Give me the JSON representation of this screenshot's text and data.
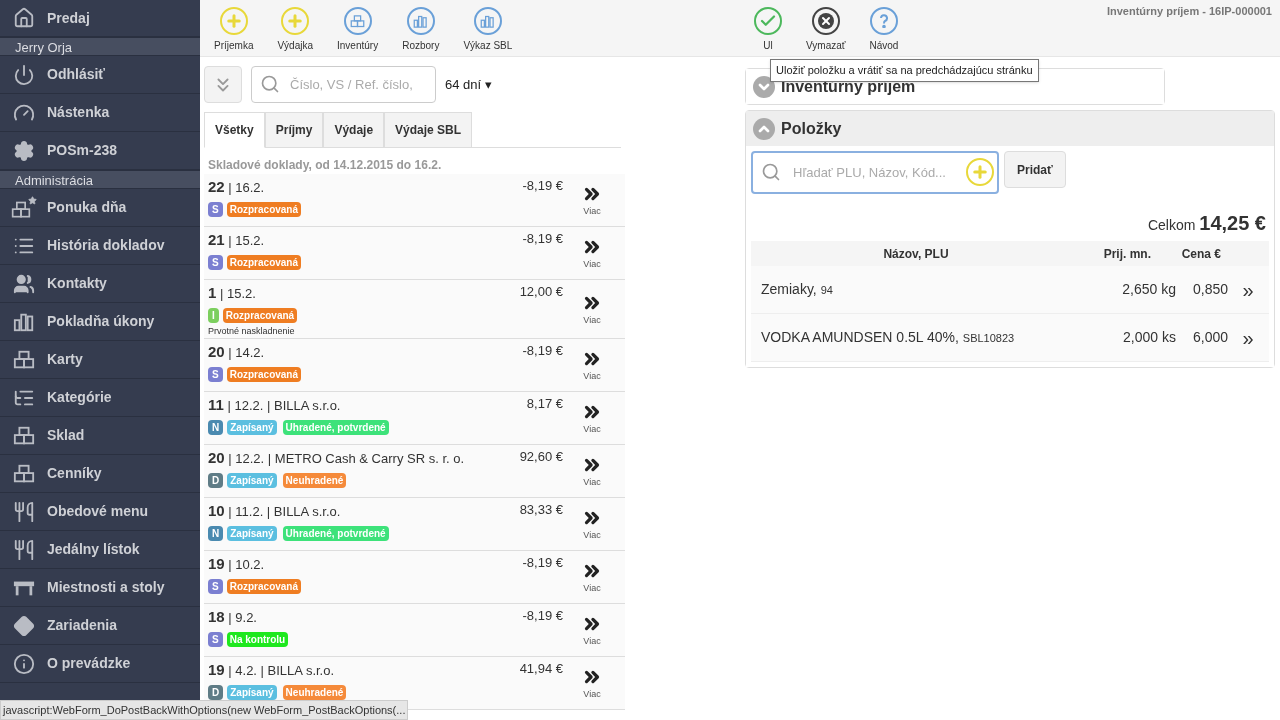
{
  "sidebar": [
    {
      "kind": "item",
      "label": "Predaj"
    },
    {
      "kind": "section",
      "label": "Jerry Orja"
    },
    {
      "kind": "item",
      "label": "Odhlásiť"
    },
    {
      "kind": "item",
      "label": "Nástenka"
    },
    {
      "kind": "item",
      "label": "POSm-238"
    },
    {
      "kind": "section",
      "label": "Administrácia"
    },
    {
      "kind": "item",
      "label": "Ponuka dňa"
    },
    {
      "kind": "item",
      "label": "História dokladov"
    },
    {
      "kind": "item",
      "label": "Kontakty"
    },
    {
      "kind": "item",
      "label": "Pokladňa úkony"
    },
    {
      "kind": "item",
      "label": "Karty"
    },
    {
      "kind": "item",
      "label": "Kategórie"
    },
    {
      "kind": "item",
      "label": "Sklad"
    },
    {
      "kind": "item",
      "label": "Cenníky"
    },
    {
      "kind": "item",
      "label": "Obedové menu"
    },
    {
      "kind": "item",
      "label": "Jedálny lístok"
    },
    {
      "kind": "item",
      "label": "Miestnosti a stoly"
    },
    {
      "kind": "item",
      "label": "Zariadenia"
    },
    {
      "kind": "item",
      "label": "O prevádzke"
    }
  ],
  "toolbar_left": [
    "Príjemka",
    "Výdajka",
    "Inventúry",
    "Rozbory",
    "Výkaz SBL"
  ],
  "toolbar_right": [
    "Ul",
    "Vymazať",
    "Návod"
  ],
  "page_title": "Inventúrny príjem - 16IP-000001",
  "tooltip": "Uložiť položku a vrátiť sa na predchádzajúcu stránku",
  "search": {
    "placeholder": "Číslo, VS / Ref. číslo,"
  },
  "period": "64 dní ▾",
  "tabs": [
    {
      "label": "Všetky",
      "selected": true
    },
    {
      "label": "Príjmy",
      "selected": false
    },
    {
      "label": "Výdaje",
      "selected": false
    },
    {
      "label": "Výdaje SBL",
      "selected": false
    }
  ],
  "list_heading": "Skladové doklady, od 14.12.2015 do 16.2.",
  "documents": [
    {
      "number": "22",
      "details": "| 16.2.",
      "amount": "-8,19 €",
      "type": {
        "label": "S",
        "color": "#7b7fd1"
      },
      "badges": [
        {
          "label": "Rozpracovaná",
          "color": "#ef7d22"
        }
      ],
      "more": "Viac"
    },
    {
      "number": "21",
      "details": "| 15.2.",
      "amount": "-8,19 €",
      "type": {
        "label": "S",
        "color": "#7b7fd1"
      },
      "badges": [
        {
          "label": "Rozpracovaná",
          "color": "#ef7d22"
        }
      ],
      "more": "Viac"
    },
    {
      "number": "1",
      "details": "| 15.2.",
      "amount": "12,00 €",
      "type": {
        "label": "I",
        "color": "#7ccf5e"
      },
      "badges": [
        {
          "label": "Rozpracovaná",
          "color": "#ef7d22"
        }
      ],
      "note": "Prvotné naskladnenie",
      "more": "Viac"
    },
    {
      "number": "20",
      "details": "| 14.2.",
      "amount": "-8,19 €",
      "type": {
        "label": "S",
        "color": "#7b7fd1"
      },
      "badges": [
        {
          "label": "Rozpracovaná",
          "color": "#ef7d22"
        }
      ],
      "more": "Viac"
    },
    {
      "number": "11",
      "details": "| 12.2. | BILLA s.r.o.",
      "amount": "8,17 €",
      "type": {
        "label": "N",
        "color": "#4a8ab0"
      },
      "badges": [
        {
          "label": "Zapísaný",
          "color": "#5bbfe0"
        },
        {
          "label": "Uhradené, potvrdené",
          "color": "#3de27a"
        }
      ],
      "more": "Viac"
    },
    {
      "number": "20",
      "details": "| 12.2. | METRO Cash & Carry SR s. r. o.",
      "amount": "92,60 €",
      "type": {
        "label": "D",
        "color": "#5f7c86"
      },
      "badges": [
        {
          "label": "Zapísaný",
          "color": "#5bbfe0"
        },
        {
          "label": "Neuhradené",
          "color": "#f58a3a"
        }
      ],
      "more": "Viac"
    },
    {
      "number": "10",
      "details": "| 11.2. | BILLA s.r.o.",
      "amount": "83,33 €",
      "type": {
        "label": "N",
        "color": "#4a8ab0"
      },
      "badges": [
        {
          "label": "Zapísaný",
          "color": "#5bbfe0"
        },
        {
          "label": "Uhradené, potvrdené",
          "color": "#3de27a"
        }
      ],
      "more": "Viac"
    },
    {
      "number": "19",
      "details": "| 10.2.",
      "amount": "-8,19 €",
      "type": {
        "label": "S",
        "color": "#7b7fd1"
      },
      "badges": [
        {
          "label": "Rozpracovaná",
          "color": "#ef7d22"
        }
      ],
      "more": "Viac"
    },
    {
      "number": "18",
      "details": "| 9.2.",
      "amount": "-8,19 €",
      "type": {
        "label": "S",
        "color": "#7b7fd1"
      },
      "badges": [
        {
          "label": "Na kontrolu",
          "color": "#1ee81e"
        }
      ],
      "more": "Viac"
    },
    {
      "number": "19",
      "details": "| 4.2. | BILLA s.r.o.",
      "amount": "41,94 €",
      "type": {
        "label": "D",
        "color": "#5f7c86"
      },
      "badges": [
        {
          "label": "Zapísaný",
          "color": "#5bbfe0"
        },
        {
          "label": "Neuhradené",
          "color": "#f58a3a"
        }
      ],
      "more": "Viac"
    }
  ],
  "panels": [
    {
      "title": "Inventúrny príjem",
      "expanded": false
    },
    {
      "title": "Položky",
      "expanded": true
    }
  ],
  "item_search": {
    "placeholder": "Hľadať PLU, Názov, Kód..."
  },
  "add_button": "Pridať",
  "total": {
    "label": "Celkom",
    "value": "14,25 €"
  },
  "items_table": {
    "columns": [
      "Názov, PLU",
      "Prij. mn.",
      "Cena €"
    ],
    "rows": [
      {
        "name": "Zemiaky,",
        "plu": "94",
        "quantity": "2,650 kg",
        "price": "0,850",
        "more": "»"
      },
      {
        "name": "VODKA AMUNDSEN 0.5L 40%,",
        "plu": "SBL10823",
        "quantity": "2,000 ks",
        "price": "6,000",
        "more": "»"
      }
    ]
  },
  "status_bar": "javascript:WebForm_DoPostBackWithOptions(new WebForm_PostBackOptions(..."
}
